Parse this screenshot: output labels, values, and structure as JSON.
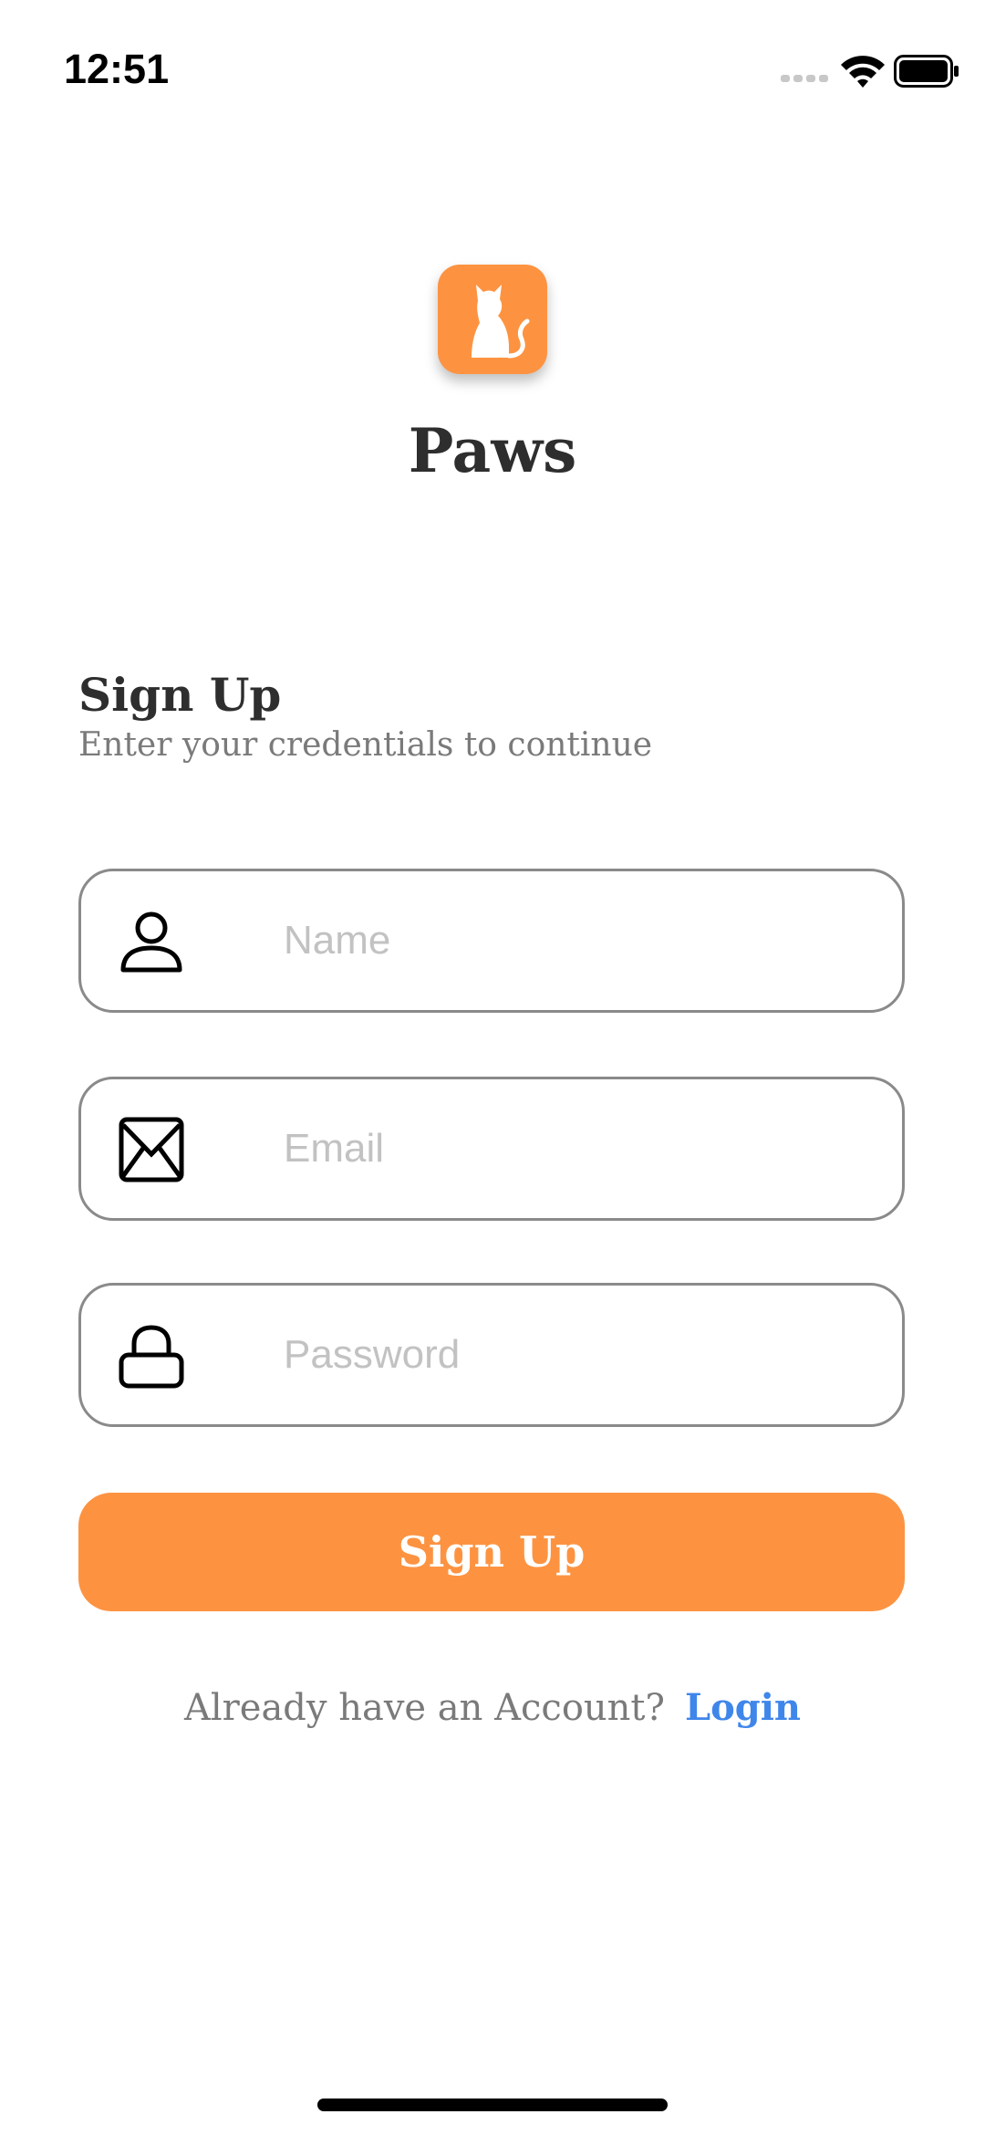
{
  "status_bar": {
    "time": "12:51",
    "icons": [
      "signal-icon",
      "wifi-icon",
      "battery-icon"
    ]
  },
  "app": {
    "name": "Paws",
    "logo_icon": "cat-icon",
    "brand_color": "#fd9341"
  },
  "form": {
    "heading": "Sign Up",
    "subheading": "Enter your credentials to continue",
    "fields": [
      {
        "icon": "person-icon",
        "placeholder": "Name",
        "value": ""
      },
      {
        "icon": "envelope-icon",
        "placeholder": "Email",
        "value": ""
      },
      {
        "icon": "lock-icon",
        "placeholder": "Password",
        "value": ""
      }
    ],
    "submit_label": "Sign Up"
  },
  "footer": {
    "prompt": "Already have an Account?",
    "link_label": "Login",
    "link_color": "#3f86ea"
  }
}
